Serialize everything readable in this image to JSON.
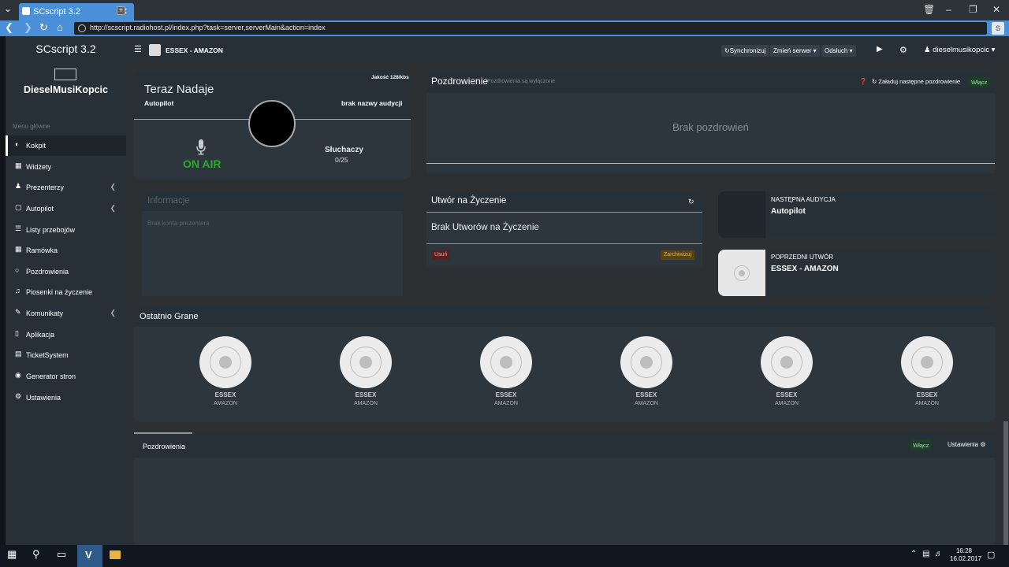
{
  "browser": {
    "tab_title": "SCscript 3.2",
    "url": "http://scscript.radiohost.pl/index.php?task=server,serverMain&action=index",
    "badge": "S"
  },
  "sidebar": {
    "brand": "SCscript 3.2",
    "user": "DieselMusiKopcic",
    "menu_header": "Menu główne",
    "items": [
      {
        "label": "Kokpit",
        "icon": "dashboard-icon"
      },
      {
        "label": "Widżety",
        "icon": "grid-icon"
      },
      {
        "label": "Prezenterzy",
        "icon": "users-icon"
      },
      {
        "label": "Autopilot",
        "icon": "autopilot-icon"
      },
      {
        "label": "Listy przebojów",
        "icon": "list-icon"
      },
      {
        "label": "Ramówka",
        "icon": "calendar-icon"
      },
      {
        "label": "Pozdrowienia",
        "icon": "message-icon"
      },
      {
        "label": "Piosenki na życzenie",
        "icon": "music-icon"
      },
      {
        "label": "Komunikaty",
        "icon": "edit-icon"
      },
      {
        "label": "Aplikacja",
        "icon": "mobile-icon"
      },
      {
        "label": "TicketSystem",
        "icon": "ticket-icon"
      },
      {
        "label": "Generator stron",
        "icon": "globe-icon"
      },
      {
        "label": "Ustawienia",
        "icon": "gear-icon"
      }
    ]
  },
  "header": {
    "station": "ESSEX - AMAZON",
    "sync": "Synchronizuj",
    "change": "Zmień serwer",
    "listen": "Odsłuch",
    "account": "dieselmusikopcic"
  },
  "now_playing": {
    "title": "Teraz Nadaje",
    "subtitle": "Autopilot",
    "quality": "Jakość 128/kbs",
    "show_name": "brak nazwy audycji",
    "on_air": "ON AIR",
    "listeners_label": "Słuchaczy",
    "listeners_value": "0/25"
  },
  "info": {
    "title": "Informacje",
    "text": "Brak konta prezentera"
  },
  "greetings": {
    "title": "Pozdrowienie",
    "subtitle": "Pozdrowienia są wyłączone",
    "load_next": "Załaduj następne pozdrowienie",
    "enable": "Włącz",
    "empty": "Brak pozdrowień"
  },
  "requests": {
    "title": "Utwór na Życzenie",
    "empty": "Brak Utworów na Życzenie",
    "delete": "Usuń",
    "archive": "Zarchiwizuj"
  },
  "next_show": {
    "header": "NASTĘPNA AUDYCJA",
    "value": "Autopilot"
  },
  "previous_track": {
    "header": "POPRZEDNI UTWÓR",
    "value": "ESSEX - AMAZON"
  },
  "recent": {
    "title": "Ostatnio Grane",
    "items": [
      {
        "artist": "ESSEX",
        "title": "AMAZON"
      },
      {
        "artist": "ESSEX",
        "title": "AMAZON"
      },
      {
        "artist": "ESSEX",
        "title": "AMAZON"
      },
      {
        "artist": "ESSEX",
        "title": "AMAZON"
      },
      {
        "artist": "ESSEX",
        "title": "AMAZON"
      },
      {
        "artist": "ESSEX",
        "title": "AMAZON"
      }
    ]
  },
  "bottom": {
    "tab": "Pozdrowienia",
    "enable": "Włącz",
    "settings": "Ustawienia"
  },
  "taskbar": {
    "time": "16:28",
    "date": "16.02.2017"
  },
  "colors": {
    "accent": "#4a90d9",
    "on_air": "#2ea82e",
    "sidebar": "#283037"
  }
}
